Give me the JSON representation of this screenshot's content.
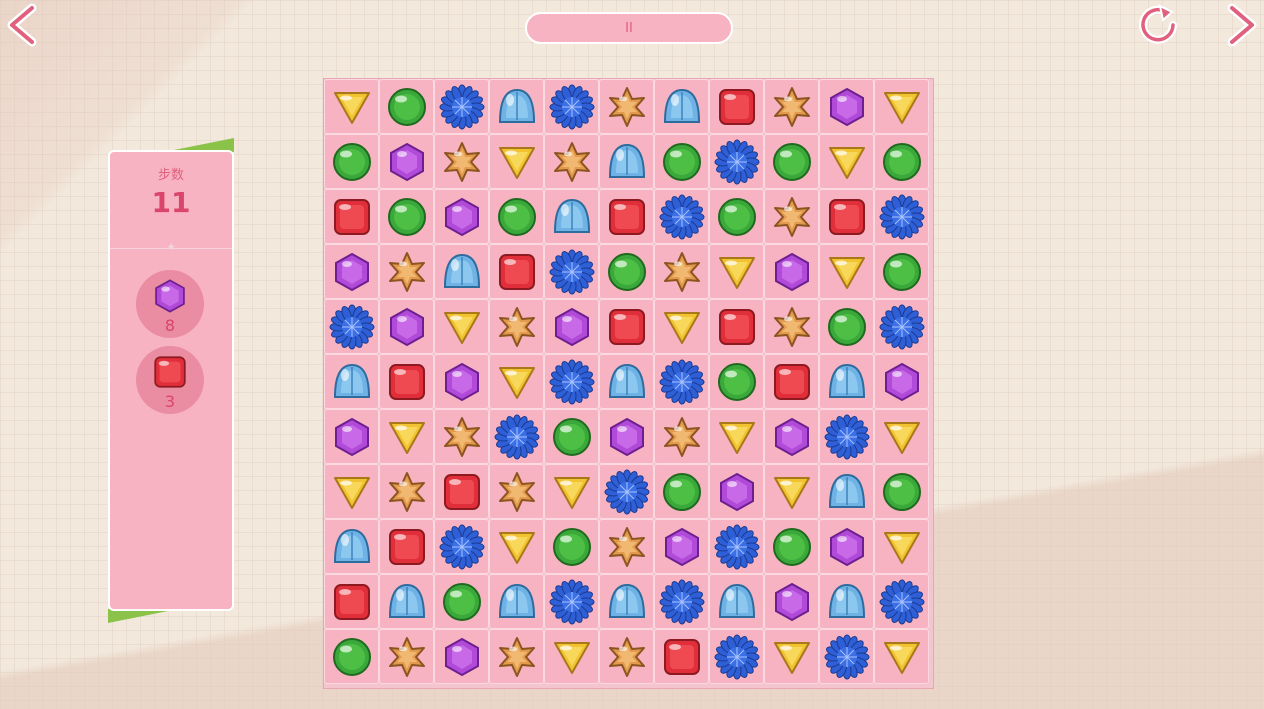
{
  "hud": {
    "back_icon": "back-arrow-icon",
    "pause_label": "II",
    "restart_icon": "restart-icon",
    "next_icon": "next-arrow-icon"
  },
  "panel": {
    "moves_label": "步数",
    "moves_value": "11",
    "goals": [
      {
        "piece": "purple-hexagon",
        "count": "8"
      },
      {
        "piece": "red-square",
        "count": "3"
      }
    ]
  },
  "colors": {
    "accent_pink": "#f7b3c2",
    "text_pink": "#d9456b",
    "panel_green": "#8bc34a"
  },
  "board": {
    "rows": 11,
    "cols": 11,
    "grid": [
      [
        "Y",
        "G",
        "B",
        "L",
        "B",
        "O",
        "L",
        "R",
        "O",
        "P",
        "Y"
      ],
      [
        "G",
        "P",
        "O",
        "Y",
        "O",
        "L",
        "G",
        "B",
        "G",
        "Y",
        "G"
      ],
      [
        "R",
        "G",
        "P",
        "G",
        "L",
        "R",
        "B",
        "G",
        "O",
        "R",
        "B"
      ],
      [
        "P",
        "O",
        "L",
        "R",
        "B",
        "G",
        "O",
        "Y",
        "P",
        "Y",
        "G"
      ],
      [
        "B",
        "P",
        "Y",
        "O",
        "P",
        "R",
        "Y",
        "R",
        "O",
        "G",
        "B"
      ],
      [
        "L",
        "R",
        "P",
        "Y",
        "B",
        "L",
        "B",
        "G",
        "R",
        "L",
        "P"
      ],
      [
        "P",
        "Y",
        "O",
        "B",
        "G",
        "P",
        "O",
        "Y",
        "P",
        "B",
        "Y"
      ],
      [
        "Y",
        "O",
        "R",
        "O",
        "Y",
        "B",
        "G",
        "P",
        "Y",
        "L",
        "G"
      ],
      [
        "L",
        "R",
        "B",
        "Y",
        "G",
        "O",
        "P",
        "B",
        "G",
        "P",
        "Y"
      ],
      [
        "R",
        "L",
        "G",
        "L",
        "B",
        "L",
        "B",
        "L",
        "P",
        "L",
        "B"
      ],
      [
        "G",
        "O",
        "P",
        "O",
        "Y",
        "O",
        "R",
        "B",
        "Y",
        "B",
        "Y"
      ]
    ],
    "legend": {
      "Y": "yellow-triangle",
      "G": "green-circle",
      "B": "blue-flower",
      "L": "lightblue-dome",
      "O": "orange-star",
      "R": "red-square",
      "P": "purple-hexagon"
    }
  }
}
